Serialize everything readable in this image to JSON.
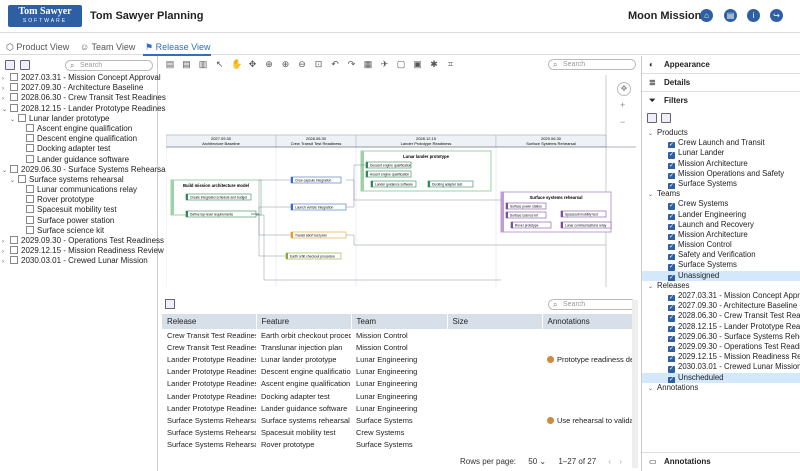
{
  "app": {
    "logo_line1": "Tom Sawyer",
    "logo_line2": "SOFTWARE",
    "title": "Tom Sawyer Planning",
    "project": "Moon Mission"
  },
  "tabs": [
    "Product View",
    "Team View",
    "Release View"
  ],
  "tree": {
    "search_placeholder": "Search",
    "items": [
      {
        "label": "2027.03.31 - Mission Concept Approval",
        "level": 0,
        "exp": "›"
      },
      {
        "label": "2027.09.30 - Architecture Baseline",
        "level": 0,
        "exp": "›"
      },
      {
        "label": "2028.06.30 - Crew Transit Test Readiness",
        "level": 0,
        "exp": "›"
      },
      {
        "label": "2028.12.15 - Lander Prototype Readiness",
        "level": 0,
        "exp": "⌄"
      },
      {
        "label": "Lunar lander prototype",
        "level": 1,
        "exp": "⌄"
      },
      {
        "label": "Ascent engine qualification",
        "level": 2,
        "exp": ""
      },
      {
        "label": "Descent engine qualification",
        "level": 2,
        "exp": ""
      },
      {
        "label": "Docking adapter test",
        "level": 2,
        "exp": ""
      },
      {
        "label": "Lander guidance software",
        "level": 2,
        "exp": ""
      },
      {
        "label": "2029.06.30 - Surface Systems Rehearsal",
        "level": 0,
        "exp": "⌄"
      },
      {
        "label": "Surface systems rehearsal",
        "level": 1,
        "exp": "⌄"
      },
      {
        "label": "Lunar communications relay",
        "level": 2,
        "exp": ""
      },
      {
        "label": "Rover prototype",
        "level": 2,
        "exp": ""
      },
      {
        "label": "Spacesuit mobility test",
        "level": 2,
        "exp": ""
      },
      {
        "label": "Surface power station",
        "level": 2,
        "exp": ""
      },
      {
        "label": "Surface science kit",
        "level": 2,
        "exp": ""
      },
      {
        "label": "2029.09.30 - Operations Test Readiness",
        "level": 0,
        "exp": "›"
      },
      {
        "label": "2029.12.15 - Mission Readiness Review",
        "level": 0,
        "exp": "›"
      },
      {
        "label": "2030.03.01 - Crewed Lunar Mission",
        "level": 0,
        "exp": "›"
      }
    ]
  },
  "canvas": {
    "search_placeholder": "Search",
    "columns": [
      {
        "date": "2027.09.30",
        "name": "Architecture Baseline"
      },
      {
        "date": "2028.06.30",
        "name": "Crew Transit Test Readiness"
      },
      {
        "date": "2028.12.15",
        "name": "Lander Prototype Readiness"
      },
      {
        "date": "2029.06.30",
        "name": "Surface Systems Rehearsal"
      }
    ],
    "groups": [
      "Build mission architecture model",
      "Lunar lander prototype",
      "Surface systems rehearsal"
    ],
    "tasks": [
      "Create integrated schedule and budget",
      "Define top-level requirements",
      "Crew capsule integration",
      "Launch vehicle integration",
      "Transit abort test plan",
      "Earth orbit checkout procedure",
      "Descent engine qualification",
      "Ascent engine qualification",
      "Lander guidance software",
      "Docking adapter test",
      "Surface power station",
      "Surface science kit",
      "Rover prototype",
      "Spacesuit mobility test",
      "Lunar communications relay"
    ]
  },
  "table": {
    "search_placeholder": "Search",
    "headers": [
      "Release",
      "Feature",
      "Team",
      "Size",
      "Annotations"
    ],
    "rows": [
      [
        "Crew Transit Test Readiness",
        "Earth orbit checkout proced",
        "Mission Control",
        "",
        ""
      ],
      [
        "Crew Transit Test Readiness",
        "Translunar injection plan",
        "Mission Control",
        "",
        ""
      ],
      [
        "Lander Prototype Readiness",
        "Lunar lander prototype",
        "Lunar Engineering",
        "",
        "Prototype readiness depe"
      ],
      [
        "Lander Prototype Readiness",
        "Descent engine qualificatio",
        "Lunar Engineering",
        "",
        ""
      ],
      [
        "Lander Prototype Readiness",
        "Ascent engine qualification",
        "Lunar Engineering",
        "",
        ""
      ],
      [
        "Lander Prototype Readiness",
        "Docking adapter test",
        "Lunar Engineering",
        "",
        ""
      ],
      [
        "Lander Prototype Readiness",
        "Lander guidance software",
        "Lunar Engineering",
        "",
        ""
      ],
      [
        "Surface Systems Rehearsal",
        "Surface systems rehearsal",
        "Surface Systems",
        "",
        "Use rehearsal to validate"
      ],
      [
        "Surface Systems Rehearsal",
        "Spacesuit mobility test",
        "Crew Systems",
        "",
        ""
      ],
      [
        "Surface Systems Rehearsal",
        "Rover prototype",
        "Surface Systems",
        "",
        ""
      ]
    ],
    "pager": {
      "label": "Rows per page:",
      "size": "50",
      "range": "1–27 of 27"
    }
  },
  "right": {
    "appearance": "Appearance",
    "details": "Details",
    "filters": "Filters",
    "annotations_footer": "Annotations",
    "filter_tree": [
      {
        "label": "Products",
        "type": "group"
      },
      {
        "label": "Crew Launch and Transit",
        "type": "item"
      },
      {
        "label": "Lunar Lander",
        "type": "item"
      },
      {
        "label": "Mission Architecture",
        "type": "item"
      },
      {
        "label": "Mission Operations and Safety",
        "type": "item"
      },
      {
        "label": "Surface Systems",
        "type": "item"
      },
      {
        "label": "Teams",
        "type": "group"
      },
      {
        "label": "Crew Systems",
        "type": "item"
      },
      {
        "label": "Lander Engineering",
        "type": "item"
      },
      {
        "label": "Launch and Recovery",
        "type": "item"
      },
      {
        "label": "Mission Architecture",
        "type": "item"
      },
      {
        "label": "Mission Control",
        "type": "item"
      },
      {
        "label": "Safety and Verification",
        "type": "item"
      },
      {
        "label": "Surface Systems",
        "type": "item"
      },
      {
        "label": "Unassigned",
        "type": "item",
        "hl": true
      },
      {
        "label": "Releases",
        "type": "group"
      },
      {
        "label": "2027.03.31 - Mission Concept Approva",
        "type": "item"
      },
      {
        "label": "2027.09.30 - Architecture Baseline",
        "type": "item"
      },
      {
        "label": "2028.06.30 - Crew Transit Test Readin",
        "type": "item"
      },
      {
        "label": "2028.12.15 - Lander Prototype Readin",
        "type": "item"
      },
      {
        "label": "2029.06.30 - Surface Systems Rehear",
        "type": "item"
      },
      {
        "label": "2029.09.30 - Operations Test Readine",
        "type": "item"
      },
      {
        "label": "2029.12.15 - Mission Readiness Revie",
        "type": "item"
      },
      {
        "label": "2030.03.01 - Crewed Lunar Mission",
        "type": "item"
      },
      {
        "label": "Unscheduled",
        "type": "item",
        "hl": true
      },
      {
        "label": "Annotations",
        "type": "group"
      }
    ]
  }
}
